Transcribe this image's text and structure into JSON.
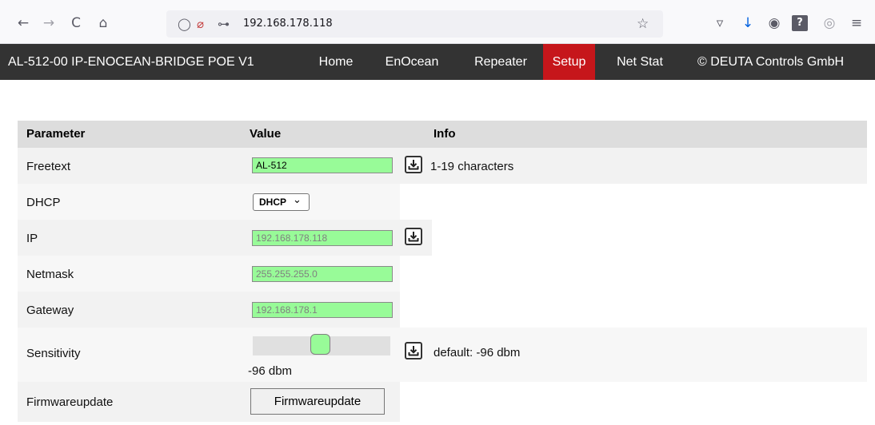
{
  "browser": {
    "back_icon": "←",
    "forward_icon": "→",
    "reload_icon": "C",
    "home_icon": "⌂",
    "shield_icon": "◯",
    "insecure_icon": "⌀",
    "permissions_icon": "⊶",
    "url": "192.168.178.118",
    "bookmark_icon": "☆",
    "pocket_icon": "▿",
    "download_icon": "↓",
    "extension_icon": "◉",
    "help_icon": "?",
    "account_icon": "◎",
    "menu_icon": "≡"
  },
  "nav": {
    "brand": "AL-512-00 IP-ENOCEAN-BRIDGE POE V1",
    "links": [
      "Home",
      "EnOcean",
      "Repeater",
      "Setup",
      "Net Stat"
    ],
    "active": "Setup",
    "copyright": "© DEUTA Controls GmbH"
  },
  "table": {
    "headers": {
      "parameter": "Parameter",
      "value": "Value",
      "info": "Info"
    },
    "rows": {
      "freetext": {
        "label": "Freetext",
        "value": "AL-512",
        "info": "1-19 characters"
      },
      "dhcp": {
        "label": "DHCP",
        "selected": "DHCP",
        "chevron": "⌄"
      },
      "ip": {
        "label": "IP",
        "value": "192.168.178.118"
      },
      "netmask": {
        "label": "Netmask",
        "value": "255.255.255.0"
      },
      "gateway": {
        "label": "Gateway",
        "value": "192.168.178.1"
      },
      "sensitivity": {
        "label": "Sensitivity",
        "value_text": "-96 dbm",
        "info": "default: -96 dbm",
        "slider_level": 0.49
      },
      "firmware": {
        "label": "Firmwareupdate",
        "button": "Firmwareupdate"
      }
    }
  },
  "colors": {
    "nav_bg": "#333333",
    "active_tab": "#c6161b",
    "field_bg": "#98fb98",
    "row_alt": "#f2f2f2",
    "header_bg": "#dddddd"
  }
}
